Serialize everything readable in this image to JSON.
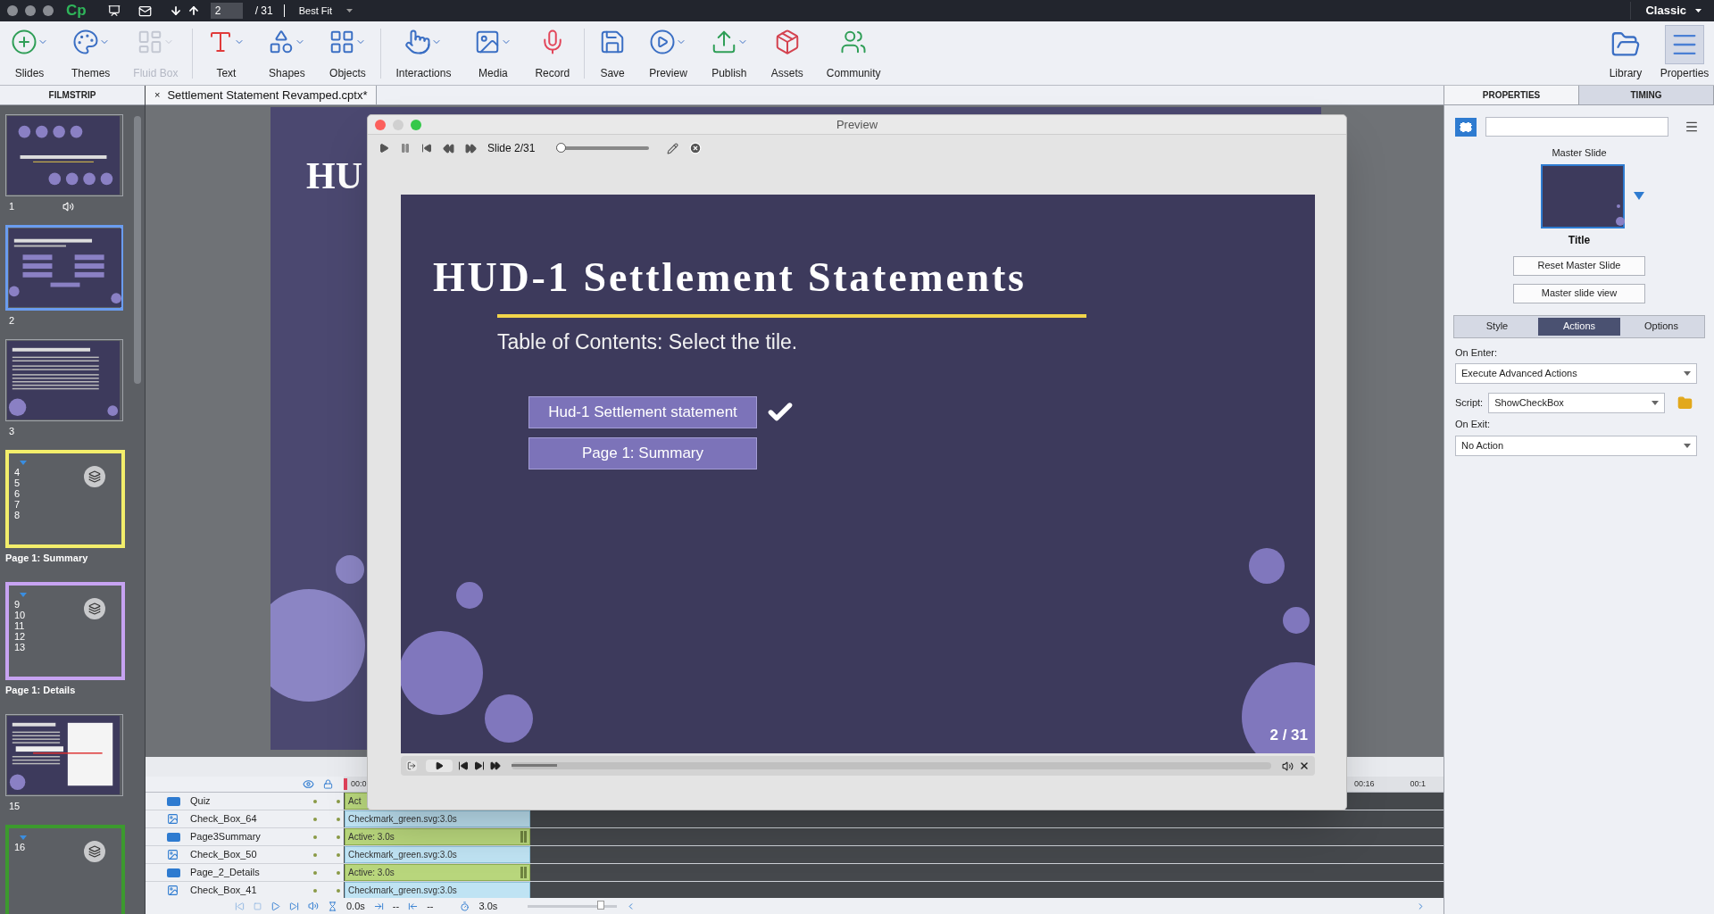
{
  "top_bar": {
    "logo": "Cp",
    "page_field": "2",
    "page_total": "/ 31",
    "zoom": "Best Fit",
    "workspace": "Classic"
  },
  "toolbar": {
    "groups": [
      [
        {
          "label": "Slides",
          "kind": "slides",
          "dropdown": true,
          "disabled": false
        },
        {
          "label": "Themes",
          "kind": "themes",
          "dropdown": true,
          "disabled": false
        },
        {
          "label": "Fluid Box",
          "kind": "fluid",
          "dropdown": true,
          "disabled": true
        }
      ],
      [
        {
          "label": "Text",
          "kind": "text",
          "dropdown": true,
          "disabled": false
        },
        {
          "label": "Shapes",
          "kind": "shapes",
          "dropdown": true,
          "disabled": false
        },
        {
          "label": "Objects",
          "kind": "objects",
          "dropdown": true,
          "disabled": false
        }
      ],
      [
        {
          "label": "Interactions",
          "kind": "interactions",
          "dropdown": true,
          "disabled": false
        },
        {
          "label": "Media",
          "kind": "media",
          "dropdown": true,
          "disabled": false
        },
        {
          "label": "Record",
          "kind": "record",
          "dropdown": false,
          "disabled": false
        }
      ],
      [
        {
          "label": "Save",
          "kind": "save",
          "dropdown": false,
          "disabled": false
        },
        {
          "label": "Preview",
          "kind": "preview",
          "dropdown": true,
          "disabled": false
        },
        {
          "label": "Publish",
          "kind": "publish",
          "dropdown": true,
          "disabled": false
        },
        {
          "label": "Assets",
          "kind": "assets",
          "dropdown": false,
          "disabled": false
        },
        {
          "label": "Community",
          "kind": "community",
          "dropdown": false,
          "disabled": false
        }
      ]
    ],
    "panels": [
      {
        "label": "Library",
        "kind": "library",
        "selected": false
      },
      {
        "label": "Properties",
        "kind": "properties",
        "selected": true
      }
    ]
  },
  "filmstrip": {
    "title": "FILMSTRIP",
    "items": [
      {
        "kind": "title",
        "number": "1",
        "selected": false,
        "audio": true
      },
      {
        "kind": "toc",
        "number": "2",
        "selected": true,
        "audio": false
      },
      {
        "kind": "text",
        "number": "3",
        "selected": false,
        "audio": false
      },
      {
        "kind": "group",
        "label": "Page 1: Summary",
        "color": "#f3ee6b",
        "numbers": [
          "4",
          "5",
          "6",
          "7",
          "8"
        ]
      },
      {
        "kind": "group",
        "label": "Page 1: Details",
        "color": "#c7a3f2",
        "numbers": [
          "9",
          "10",
          "11",
          "12",
          "13"
        ]
      },
      {
        "kind": "table",
        "number": "15",
        "selected": false,
        "audio": false
      },
      {
        "kind": "group",
        "color": "#3c9a2e",
        "numbers": [
          "16"
        ]
      }
    ]
  },
  "document_tab": {
    "close": "×",
    "title": "Settlement Statement Revamped.cptx*"
  },
  "stage": {
    "title_fragment": "HU"
  },
  "timeline": {
    "ruler": {
      "start": "00:0",
      "end": [
        "00:16",
        "00:1"
      ]
    },
    "layers": [
      {
        "name": "Quiz",
        "kind": "button",
        "bar": "Act",
        "handle": false
      },
      {
        "name": "Check_Box_64",
        "kind": "image",
        "bar": "Checkmark_green.svg:3.0s"
      },
      {
        "name": "Page3Summary",
        "kind": "button",
        "bar": "Active: 3.0s",
        "handle": true
      },
      {
        "name": "Check_Box_50",
        "kind": "image",
        "bar": "Checkmark_green.svg:3.0s"
      },
      {
        "name": "Page_2_Details",
        "kind": "button",
        "bar": "Active: 3.0s",
        "handle": true
      },
      {
        "name": "Check_Box_41",
        "kind": "image",
        "bar": "Checkmark_green.svg:3.0s"
      }
    ],
    "footer": {
      "start": "0.0s",
      "in": "--",
      "out": "--",
      "duration": "3.0s",
      "zoom": {
        "level": 0.85
      }
    }
  },
  "preview": {
    "title": "Preview",
    "slide_label": "Slide 2/31",
    "scrub": {
      "level": 0
    },
    "slide": {
      "title": "HUD-1 Settlement Statements",
      "subtitle": "Table of Contents: Select the tile.",
      "tiles": [
        {
          "label": "Hud-1 Settlement statement",
          "checked": true
        },
        {
          "label": "Page 1: Summary",
          "checked": false
        }
      ],
      "counter": "2 / 31"
    },
    "progress": {
      "level": 0.06
    }
  },
  "properties": {
    "tabs": [
      {
        "label": "PROPERTIES",
        "selected": true
      },
      {
        "label": "TIMING",
        "selected": false
      }
    ],
    "master_label": "Master Slide",
    "master_name": "Title",
    "buttons": [
      "Reset Master Slide",
      "Master slide view"
    ],
    "subtabs": [
      {
        "label": "Style",
        "selected": false
      },
      {
        "label": "Actions",
        "selected": true
      },
      {
        "label": "Options",
        "selected": false
      }
    ],
    "on_enter": {
      "label": "On Enter:",
      "value": "Execute Advanced Actions"
    },
    "script": {
      "label": "Script:",
      "value": "ShowCheckBox"
    },
    "on_exit": {
      "label": "On Exit:",
      "value": "No Action"
    }
  }
}
